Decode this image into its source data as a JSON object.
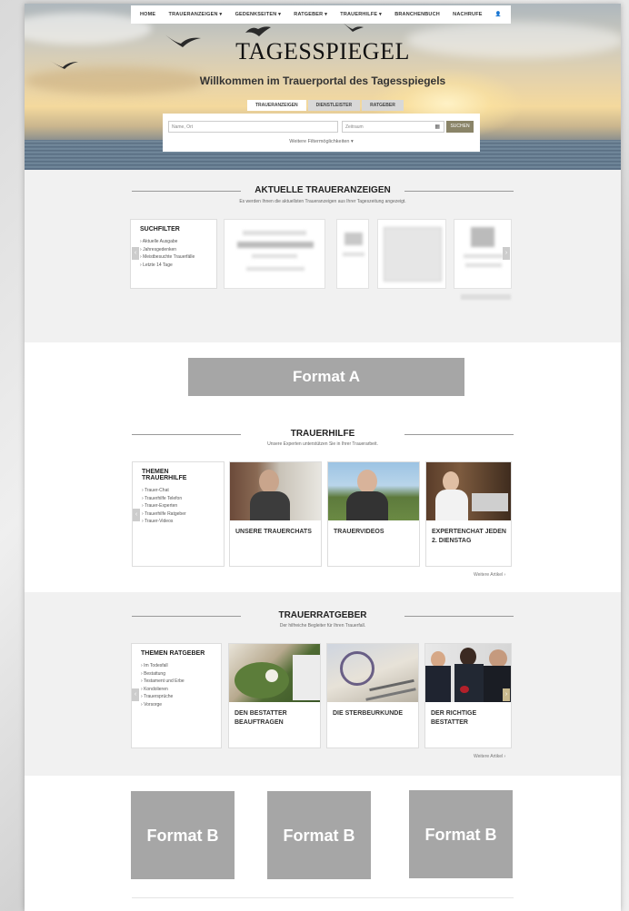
{
  "nav": {
    "items": [
      "HOME",
      "TRAUERANZEIGEN ▾",
      "GEDENKSEITEN ▾",
      "RATGEBER ▾",
      "TRAUERHILFE ▾",
      "BRANCHENBUCH",
      "NACHRUFE",
      "👤"
    ]
  },
  "hero": {
    "logo": "TAGESSPIEGEL",
    "welcome": "Willkommen im Trauerportal des Tagesspiegels",
    "tabs": [
      "TRAUERANZEIGEN",
      "DIENSTLEISTER",
      "RATGEBER"
    ],
    "search_placeholder": "Name, Ort",
    "date_placeholder": "Zeitraum",
    "search_button": "SUCHEN",
    "more_filters": "Weitere Filtermöglichkeiten ▾"
  },
  "aktuelle": {
    "title": "AKTUELLE TRAUERANZEIGEN",
    "subtitle": "Es werden Ihnen die aktuellsten Traueranzeigen aus Ihrer Tageszeitung angezeigt.",
    "filter_title": "SUCHFILTER",
    "filter_items": [
      "Aktuelle Ausgabe",
      "Jahresgedenken",
      "Meistbesuchte Trauerfälle",
      "Letzte 14 Tage"
    ]
  },
  "format_a": "Format A",
  "trauerhilfe": {
    "title": "TRAUERHILFE",
    "subtitle": "Unsere Experten unterstützen Sie in Ihrer Trauerarbeit.",
    "filter_title": "THEMEN TRAUERHILFE",
    "filter_items": [
      "Trauer-Chat",
      "Trauerhilfe Telefon",
      "Trauer-Experten",
      "Trauerhilfe Ratgeber",
      "Trauer-Videos"
    ],
    "cards": [
      "UNSERE TRAUERCHATS",
      "TRAUERVIDEOS",
      "EXPERTENCHAT JEDEN 2. DIENSTAG"
    ],
    "more": "Weitere Artikel ›"
  },
  "ratgeber": {
    "title": "TRAUERRATGEBER",
    "subtitle": "Der hilfreiche Begleiter für Ihren Trauerfall.",
    "filter_title": "THEMEN RATGEBER",
    "filter_items": [
      "Im Todesfall",
      "Bestattung",
      "Testament und Erbe",
      "Kondolieren",
      "Trauersprüche",
      "Vorsorge"
    ],
    "cards": [
      "DEN BESTATTER BEAUFTRAGEN",
      "DIE STERBEURKUNDE",
      "DER RICHTIGE BESTATTER"
    ],
    "more": "Weitere Artikel ›"
  },
  "format_b": [
    "Format B",
    "Format B",
    "Format B"
  ],
  "colors": {
    "accent": "#8a8468",
    "placeholder_grey": "#a6a6a6",
    "section_bg": "#f1f1f1"
  }
}
